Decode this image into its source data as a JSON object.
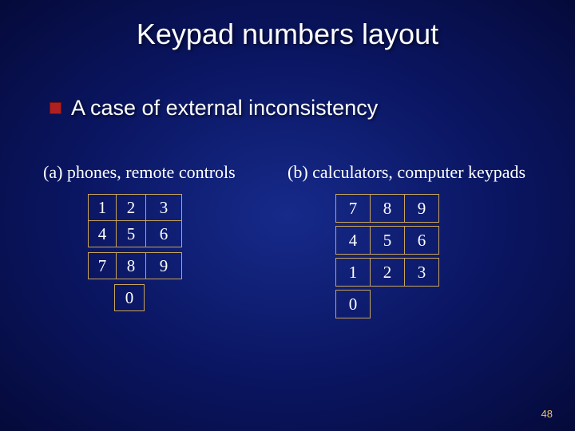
{
  "title": "Keypad numbers layout",
  "bullet": "A case of external inconsistency",
  "caption_a": "(a) phones, remote controls",
  "caption_b": "(b) calculators, computer keypads",
  "pad_a": {
    "r1": [
      "1",
      "2",
      "3"
    ],
    "r2": [
      "4",
      "5",
      "6"
    ],
    "r3": [
      "7",
      "8",
      "9"
    ],
    "r4": [
      "0"
    ]
  },
  "pad_b": {
    "r1": [
      "7",
      "8",
      "9"
    ],
    "r2": [
      "4",
      "5",
      "6"
    ],
    "r3": [
      "1",
      "2",
      "3"
    ],
    "r4": [
      "0"
    ]
  },
  "slide_number": "48",
  "chart_data": {
    "type": "table",
    "title": "Keypad numbers layout",
    "series": [
      {
        "name": "(a) phones, remote controls",
        "grid": [
          [
            "1",
            "2",
            "3"
          ],
          [
            "4",
            "5",
            "6"
          ],
          [
            "7",
            "8",
            "9"
          ],
          [
            "",
            "0",
            ""
          ]
        ]
      },
      {
        "name": "(b) calculators, computer keypads",
        "grid": [
          [
            "7",
            "8",
            "9"
          ],
          [
            "4",
            "5",
            "6"
          ],
          [
            "1",
            "2",
            "3"
          ],
          [
            "0",
            "",
            ""
          ]
        ]
      }
    ]
  }
}
